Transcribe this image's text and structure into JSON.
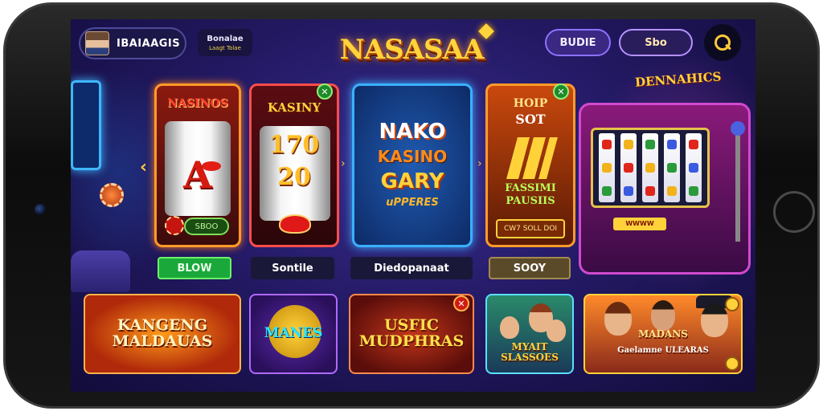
{
  "user": {
    "name": "IBAIAAGIS",
    "balance_label": "Bonalae",
    "balance_sub": "Laagt Tolae"
  },
  "logo": {
    "text": "NASASAA"
  },
  "top_buttons": {
    "buide": "BUDIE",
    "sho": "Sbo"
  },
  "carousel": {
    "cards": [
      {
        "title": "NASINOS",
        "symbol": "A",
        "pill": "SBOO"
      },
      {
        "title": "KASINY",
        "line1": "170",
        "line2": "20"
      },
      {
        "line1": "NAKO",
        "line2": "KASINO",
        "line3": "GARY",
        "line4": "uPPERES"
      },
      {
        "top": "HOIP",
        "sub": "SOT",
        "name": "FASSIMI PAUSIIS",
        "badge": "CW7 SOLL DOI"
      }
    ],
    "labels": [
      "BLOW",
      "Sontile",
      "Diedopanaat",
      "SOOY"
    ]
  },
  "slot_machine": {
    "title": "DENNAHICS",
    "bar_text": "WWWW"
  },
  "bottom_tiles": [
    {
      "text": "KANGENG MALDAUAS"
    },
    {
      "text": "MANES"
    },
    {
      "text": "USFIC MUDPHRAS"
    },
    {
      "text": "MYAIT SLASSOES"
    },
    {
      "text": "MADANS",
      "sub": "Gaelamne ULEARAS"
    }
  ],
  "icons": {
    "search": "search-icon",
    "close": "close-icon",
    "prev": "chevron-left-icon"
  }
}
